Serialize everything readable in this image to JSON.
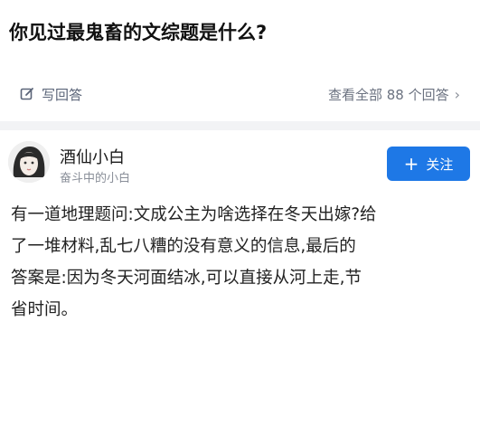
{
  "question": {
    "title": "你见过最鬼畜的文综题是什么?"
  },
  "actions": {
    "write_answer_label": "写回答",
    "view_all_label": "查看全部 88 个回答",
    "write_icon": "edit-icon",
    "chevron_icon": "chevron-right-icon"
  },
  "author": {
    "name": "酒仙小白",
    "bio": "奋斗中的小白",
    "follow_label": "关注",
    "follow_icon": "plus-icon"
  },
  "answer": {
    "lines": [
      "有一道地理题问:文成公主为啥选择在冬天出嫁?给",
      "了一堆材料,乱七八糟的没有意义的信息,最后的",
      "答案是:因为冬天河面结冰,可以直接从河上走,节",
      "省时间。"
    ]
  },
  "colors": {
    "accent": "#1e78e6",
    "muted_text": "#8a8f99",
    "divider": "#f2f3f5"
  }
}
